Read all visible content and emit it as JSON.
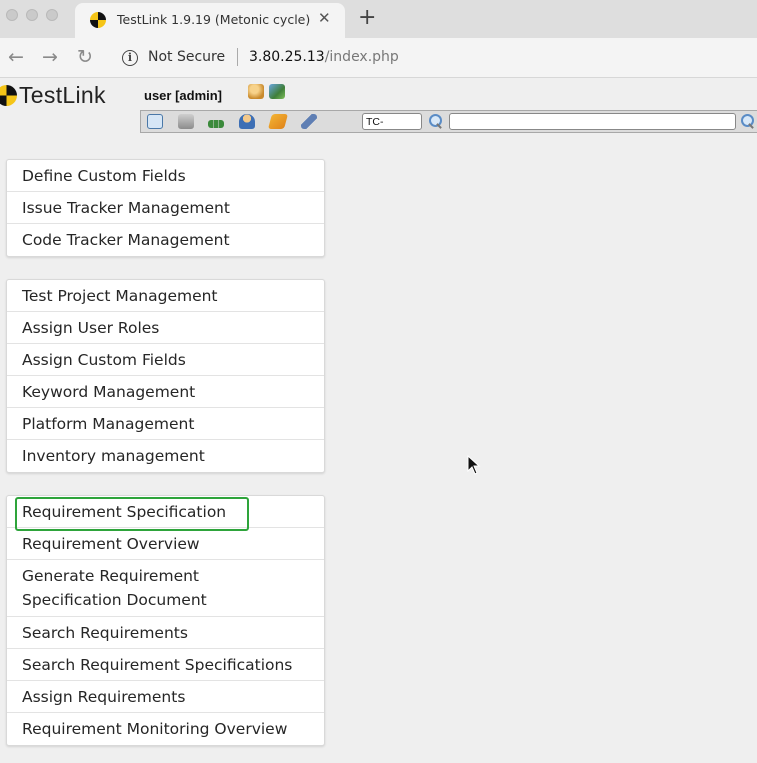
{
  "browser": {
    "tab_title": "TestLink 1.9.19 (Metonic cycle)",
    "tab_close": "✕",
    "new_tab": "+",
    "back": "←",
    "forward": "→",
    "reload": "↻",
    "security_label": "Not Secure",
    "url_host": "3.80.25.13",
    "url_path": "/index.php"
  },
  "header": {
    "logo_text": "TestLink",
    "user_label": "user [admin]",
    "tc_prefix": "TC-",
    "search_value": ""
  },
  "menus": {
    "group1": [
      {
        "label": "Define Custom Fields"
      },
      {
        "label": "Issue Tracker Management"
      },
      {
        "label": "Code Tracker Management"
      }
    ],
    "group2": [
      {
        "label": "Test Project Management"
      },
      {
        "label": "Assign User Roles"
      },
      {
        "label": "Assign Custom Fields"
      },
      {
        "label": "Keyword Management"
      },
      {
        "label": "Platform Management"
      },
      {
        "label": "Inventory management"
      }
    ],
    "group3": [
      {
        "label": "Requirement Specification"
      },
      {
        "label": "Requirement Overview"
      },
      {
        "label": "Generate Requirement\nSpecification Document"
      },
      {
        "label": "Search Requirements"
      },
      {
        "label": "Search Requirement Specifications"
      },
      {
        "label": "Assign Requirements"
      },
      {
        "label": "Requirement Monitoring Overview"
      }
    ]
  },
  "colors": {
    "highlight": "#2ea43b",
    "logo_yellow": "#f5c518"
  },
  "icons": {
    "toolbar": [
      "desktop-icon",
      "cart-icon",
      "hierarchy-icon",
      "user-icon",
      "bullhorn-icon",
      "wrench-icon"
    ],
    "header": [
      "user-edit-icon",
      "logout-icon"
    ]
  }
}
